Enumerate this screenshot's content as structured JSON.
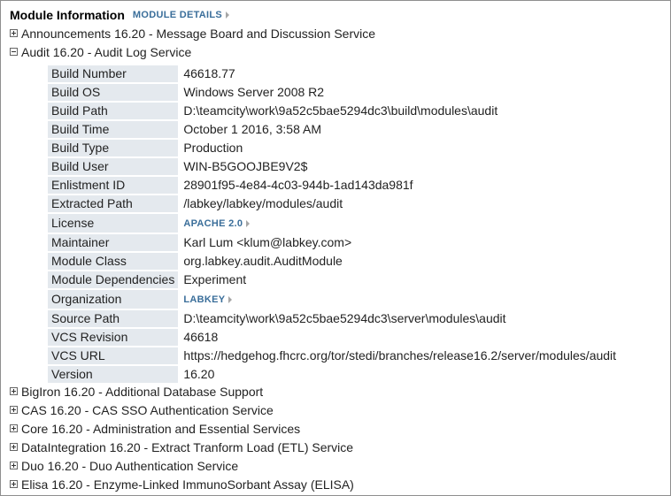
{
  "header": {
    "title": "Module Information",
    "details_link": "MODULE DETAILS"
  },
  "modules_top": [
    {
      "label": "Announcements 16.20 - Message Board and Discussion Service",
      "expanded": false
    },
    {
      "label": "Audit 16.20 - Audit Log Service",
      "expanded": true
    }
  ],
  "audit_properties": [
    {
      "name": "Build Number",
      "value": "46618.77"
    },
    {
      "name": "Build OS",
      "value": "Windows Server 2008 R2"
    },
    {
      "name": "Build Path",
      "value": "D:\\teamcity\\work\\9a52c5bae5294dc3\\build\\modules\\audit"
    },
    {
      "name": "Build Time",
      "value": "October 1 2016, 3:58 AM"
    },
    {
      "name": "Build Type",
      "value": "Production"
    },
    {
      "name": "Build User",
      "value": "WIN-B5GOOJBE9V2$"
    },
    {
      "name": "Enlistment ID",
      "value": "28901f95-4e84-4c03-944b-1ad143da981f"
    },
    {
      "name": "Extracted Path",
      "value": "/labkey/labkey/modules/audit"
    },
    {
      "name": "License",
      "value": "APACHE 2.0"
    },
    {
      "name": "Maintainer",
      "value": "Karl Lum <klum@labkey.com>"
    },
    {
      "name": "Module Class",
      "value": "org.labkey.audit.AuditModule"
    },
    {
      "name": "Module Dependencies",
      "value": "Experiment"
    },
    {
      "name": "Organization",
      "value": "LABKEY"
    },
    {
      "name": "Source Path",
      "value": "D:\\teamcity\\work\\9a52c5bae5294dc3\\server\\modules\\audit"
    },
    {
      "name": "VCS Revision",
      "value": "46618"
    },
    {
      "name": "VCS URL",
      "value": "https://hedgehog.fhcrc.org/tor/stedi/branches/release16.2/server/modules/audit"
    },
    {
      "name": "Version",
      "value": "16.20"
    }
  ],
  "modules_bottom": [
    {
      "label": "BigIron 16.20 - Additional Database Support",
      "expanded": false
    },
    {
      "label": "CAS 16.20 - CAS SSO Authentication Service",
      "expanded": false
    },
    {
      "label": "Core 16.20 - Administration and Essential Services",
      "expanded": false
    },
    {
      "label": "DataIntegration 16.20 - Extract Tranform Load (ETL) Service",
      "expanded": false
    },
    {
      "label": "Duo 16.20 - Duo Authentication Service",
      "expanded": false
    },
    {
      "label": "Elisa 16.20 - Enzyme-Linked ImmunoSorbant Assay (ELISA)",
      "expanded": false
    }
  ],
  "icons": {
    "expand": "plus-box-icon",
    "collapse": "minus-box-icon",
    "link_arrow": "triangle-right-icon"
  },
  "colors": {
    "link": "#3a6e9a",
    "property_name_bg": "#e4e9ee",
    "border": "#8f8f8f"
  }
}
